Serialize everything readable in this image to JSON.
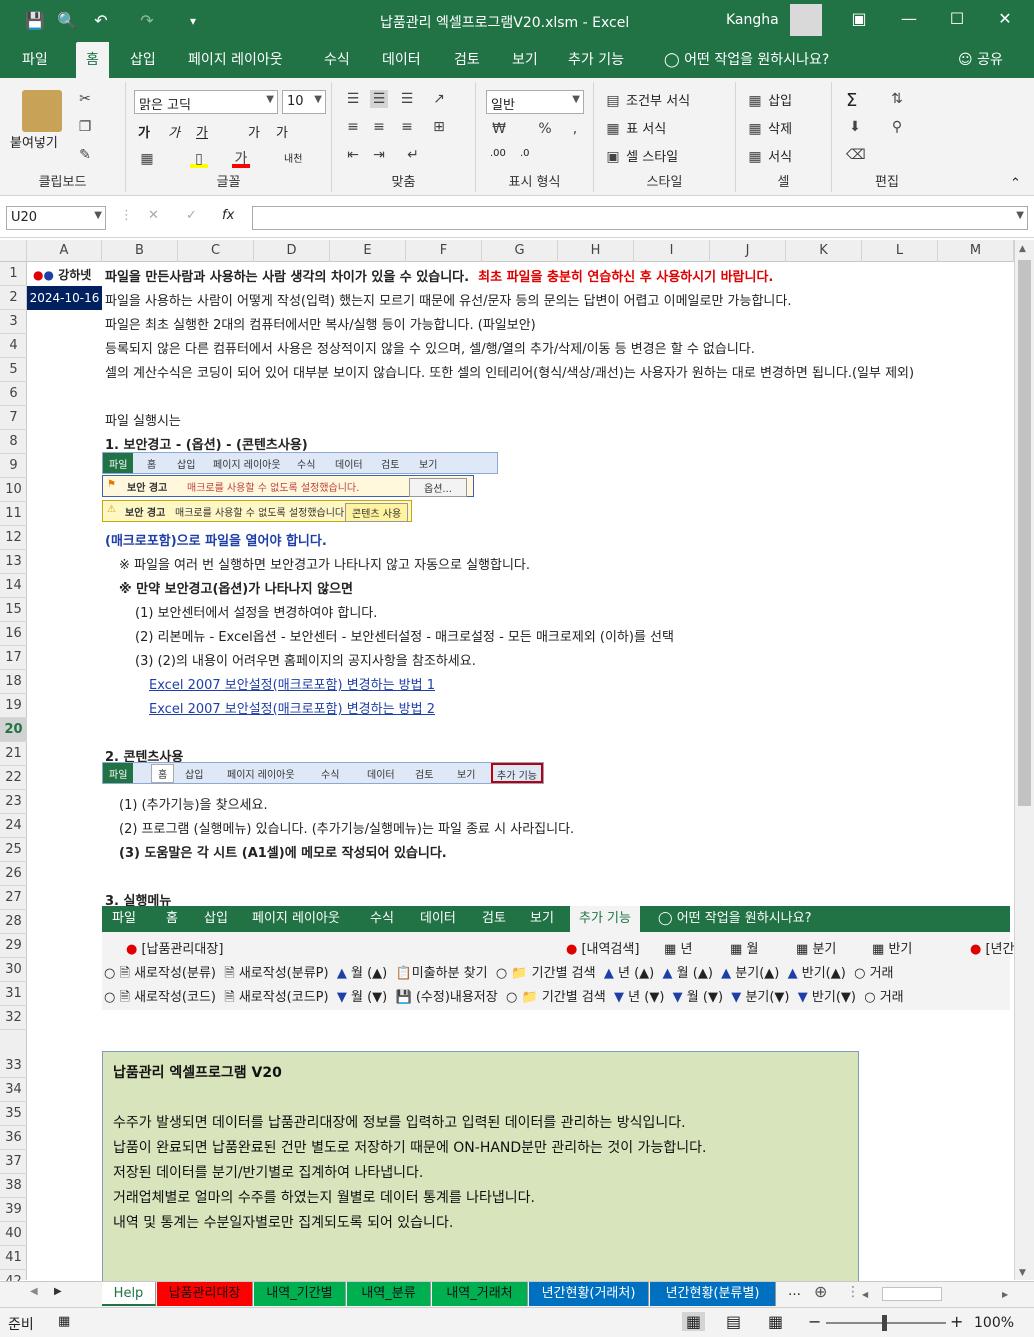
{
  "window": {
    "title": "납품관리 엑셀프로그램V20.xlsm  -  Excel",
    "user": "Kangha"
  },
  "menu_tabs": [
    "파일",
    "홈",
    "삽입",
    "페이지 레이아웃",
    "수식",
    "데이터",
    "검토",
    "보기",
    "추가 기능"
  ],
  "tell_me": "어떤 작업을 원하시나요?",
  "share": "공유",
  "ribbon": {
    "clipboard": {
      "paste": "붙여넣기",
      "label": "클립보드"
    },
    "font": {
      "name": "맑은 고딕",
      "size": "10",
      "label": "글꼴"
    },
    "align": {
      "label": "맞춤"
    },
    "number": {
      "format": "일반",
      "label": "표시 형식"
    },
    "styles": {
      "conditional": "조건부 서식",
      "table": "표 서식",
      "cell": "셀 스타일",
      "label": "스타일"
    },
    "cells": {
      "insert": "삽입",
      "delete": "삭제",
      "format": "서식",
      "label": "셀"
    },
    "editing": {
      "label": "편집"
    }
  },
  "formula_bar": {
    "name_box": "U20",
    "formula": ""
  },
  "columns": [
    "A",
    "B",
    "C",
    "D",
    "E",
    "F",
    "G",
    "H",
    "I",
    "J",
    "K",
    "L",
    "M"
  ],
  "rows": [
    "1",
    "2",
    "3",
    "4",
    "5",
    "6",
    "7",
    "8",
    "9",
    "10",
    "11",
    "12",
    "13",
    "14",
    "15",
    "16",
    "17",
    "18",
    "19",
    "20",
    "21",
    "22",
    "23",
    "24",
    "25",
    "26",
    "27",
    "28",
    "29",
    "30",
    "31",
    "32",
    "33",
    "34",
    "35",
    "36",
    "37",
    "38",
    "39",
    "40",
    "41",
    "42"
  ],
  "sheet": {
    "logo": "강하넷",
    "date": "2024-10-16",
    "r1a": "파일을 만든사람과 사용하는 사람 생각의 차이가 있을 수 있습니다.",
    "r1b": "최초 파일을 충분히 연습하신 후 사용하시기 바랍니다.",
    "r2": "파일을 사용하는 사람이 어떻게 작성(입력) 했는지 모르기 때문에 유선/문자 등의 문의는 답변이 어렵고 이메일로만 가능합니다.",
    "r3": "파일은 최초 실행한 2대의 컴퓨터에서만 복사/실행 등이 가능합니다.  (파일보안)",
    "r4": "등록되지 않은 다른 컴퓨터에서 사용은 정상적이지 않을 수 있으며, 셀/행/열의 추가/삭제/이동 등 변경은 할 수 없습니다.",
    "r5": "셀의 계산수식은 코딩이 되어 있어 대부분 보이지 않습니다. 또한 셀의 인테리어(형식/색상/괘선)는 사용자가 원하는 대로 변경하면 됩니다.(일부 제외)",
    "r7": "파일 실행시는",
    "r8": "1. 보안경고 - (옵션) - (콘텐츠사용)",
    "r12": "(매크로포함)으로 파일을 열어야 합니다.",
    "r13": "※ 파일을 여러 번 실행하면 보안경고가 나타나지 않고 자동으로 실행합니다.",
    "r14": "※ 만약 보안경고(옵션)가 나타나지 않으면",
    "r15": "(1) 보안센터에서 설정을 변경하여야 합니다.",
    "r16": "(2) 리본메뉴 - Excel옵션 - 보안센터 - 보안센터설정 - 매크로설정 - 모든 매크로제외 (이하)를 선택",
    "r17": "(3) (2)의 내용이 어려우면 홈페이지의 공지사항을 참조하세요.",
    "r18": "Excel 2007 보안설정(매크로포함) 변경하는 방법 1",
    "r19": "Excel 2007 보안설정(매크로포함) 변경하는 방법 2",
    "r21": "2. 콘텐츠사용",
    "r23": "(1) (추가기능)을 찾으세요.",
    "r24": "(2) 프로그램 (실행메뉴) 있습니다. (추가기능/실행메뉴)는 파일 종료 시 사라집니다.",
    "r25": "(3) 도움말은 각 시트 (A1셀)에 메모로 작성되어 있습니다.",
    "r27": "3. 실행메뉴"
  },
  "mini_ribbon_1": {
    "tabs": [
      "파일",
      "홈",
      "삽입",
      "페이지 레이아웃",
      "수식",
      "데이터",
      "검토",
      "보기"
    ],
    "warn1_title": "보안 경고",
    "warn1_text": "매크로를 사용할 수 없도록 설정했습니다.",
    "warn1_btn": "옵션...",
    "warn2_title": "보안 경고",
    "warn2_text": "매크로를 사용할 수 없도록 설정했습니다.",
    "warn2_btn": "콘텐츠 사용"
  },
  "mini_ribbon_2": {
    "tabs": [
      "파일",
      "홈",
      "삽입",
      "페이지 레이아웃",
      "수식",
      "데이터",
      "검토",
      "보기",
      "추가 기능"
    ]
  },
  "big_ribbon": {
    "tabs": [
      "파일",
      "홈",
      "삽입",
      "페이지 레이아웃",
      "수식",
      "데이터",
      "검토",
      "보기",
      "추가 기능"
    ],
    "tell_me": "어떤 작업을 원하시나요?",
    "group1": "[납품관리대장]",
    "group2": "[내역검색]",
    "year": "년",
    "month": "월",
    "quarter": "분기",
    "half": "반기",
    "group3": "[년간",
    "row1": [
      "새로작성(분류)",
      "새로작성(분류P)",
      "월 (▲)",
      "미출하분 찾기",
      "기간별 검색",
      "년 (▲)",
      "월 (▲)",
      "분기(▲)",
      "반기(▲)",
      "거래"
    ],
    "row2": [
      "새로작성(코드)",
      "새로작성(코드P)",
      "월 (▼)",
      "(수정)내용저장",
      "기간별 검색",
      "년 (▼)",
      "월 (▼)",
      "분기(▼)",
      "반기(▼)",
      "거래"
    ]
  },
  "info_box": {
    "title": "납품관리 엑셀프로그램 V20",
    "lines": [
      "수주가 발생되면 데이터를 납품관리대장에 정보를 입력하고 입력된 데이터를 관리하는 방식입니다.",
      "납품이 완료되면 납품완료된 건만 별도로 저장하기 때문에 ON-HAND분만 관리하는 것이 가능합니다.",
      "저장된 데이터를 분기/반기별로 집계하여 나타냅니다.",
      "거래업체별로 얼마의 수주를 하였는지 월별로 데이터 통계를 나타냅니다.",
      "내역 및 통계는 수분일자별로만 집계되도록 되어 있습니다."
    ]
  },
  "sheet_tabs": [
    {
      "label": "Help",
      "color": "#ffffff"
    },
    {
      "label": "납품관리대장",
      "color": "#ff0000"
    },
    {
      "label": "내역_기간별",
      "color": "#00b050"
    },
    {
      "label": "내역_분류",
      "color": "#00b050"
    },
    {
      "label": "내역_거래처",
      "color": "#00b050"
    },
    {
      "label": "년간현황(거래처)",
      "color": "#0070c0"
    },
    {
      "label": "년간현황(분류별)",
      "color": "#0070c0"
    }
  ],
  "status": {
    "ready": "준비",
    "zoom": "100%"
  },
  "colors": {
    "excel_green": "#217346",
    "info_box": "#d8e4bc",
    "warning_red": "#e00000",
    "link_blue": "#1f3fa8"
  }
}
